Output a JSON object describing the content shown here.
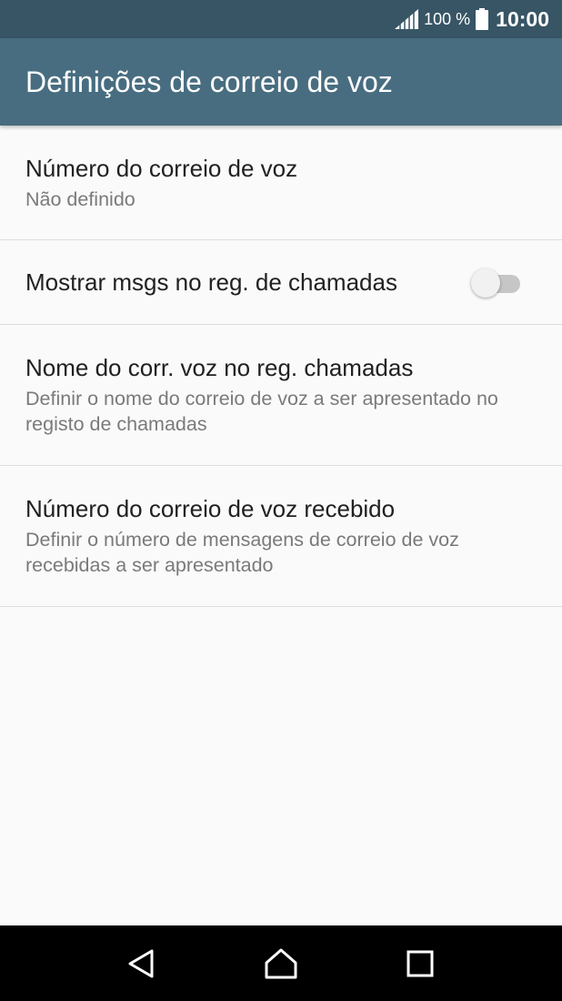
{
  "status_bar": {
    "battery_percent": "100 %",
    "time": "10:00",
    "icons": [
      "signal-icon",
      "battery-icon"
    ]
  },
  "app_bar": {
    "title": "Definições de correio de voz"
  },
  "settings": [
    {
      "title": "Número do correio de voz",
      "summary": "Não definido"
    },
    {
      "title": "Mostrar msgs no reg. de chamadas",
      "toggle_on": false
    },
    {
      "title": "Nome do corr. voz no reg. chamadas",
      "summary": "Definir o nome do correio de voz a ser apresentado no registo de chamadas"
    },
    {
      "title": "Número do correio de voz recebido",
      "summary": "Definir o número de mensagens de correio de voz recebidas a ser apresentado"
    }
  ],
  "nav_bar": {
    "icons": [
      "back-icon",
      "home-icon",
      "recents-icon"
    ]
  },
  "colors": {
    "status_bar": "#375565",
    "app_bar": "#486d80",
    "background": "#fafafa"
  }
}
